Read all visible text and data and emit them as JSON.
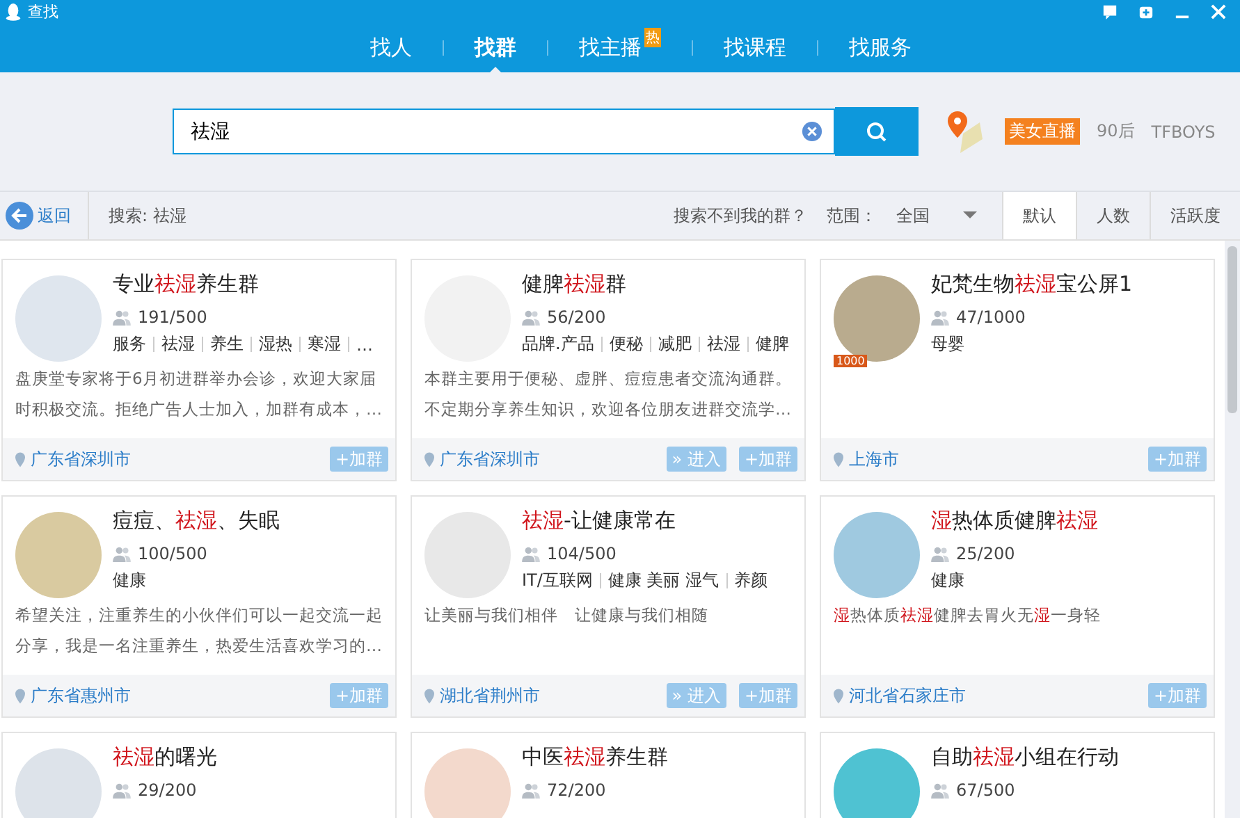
{
  "window": {
    "title": "查找"
  },
  "tabs": [
    {
      "label": "找人",
      "selected": false
    },
    {
      "label": "找群",
      "selected": true
    },
    {
      "label": "找主播",
      "selected": false,
      "badge": "热"
    },
    {
      "label": "找课程",
      "selected": false
    },
    {
      "label": "找服务",
      "selected": false
    }
  ],
  "search": {
    "value": "祛湿"
  },
  "hot_words": [
    {
      "label": "美女直播",
      "kind": "tag"
    },
    {
      "label": "90后",
      "kind": "plain"
    },
    {
      "label": "TFBOYS",
      "kind": "plain"
    }
  ],
  "toolbar": {
    "back": "返回",
    "query": "搜索: 祛湿",
    "not_found": "搜索不到我的群？",
    "scope_label": "范围：",
    "scope": "全国",
    "sorts": [
      {
        "label": "默认",
        "selected": true
      },
      {
        "label": "人数",
        "selected": false
      },
      {
        "label": "活跃度",
        "selected": false
      }
    ]
  },
  "groups": [
    {
      "title": "专业**祛湿**养生群",
      "members": "191/500",
      "tags": [
        "服务",
        "祛湿",
        "养生",
        "湿热",
        "寒湿",
        "…"
      ],
      "description": "盘庚堂专家将于6月初进群举办会诊，欢迎大家届时积极交流。拒绝广告人士加入，加群有成本，…",
      "location": "广东省深圳市",
      "buttons": [
        "+加群"
      ]
    },
    {
      "title": "健脾**祛湿**群",
      "members": "56/200",
      "tags": [
        "品牌.产品",
        "便秘",
        "减肥",
        "祛湿",
        "健脾"
      ],
      "description": "本群主要用于便秘、虚胖、痘痘患者交流沟通群。不定期分享养生知识，欢迎各位朋友进群交流学…",
      "location": "广东省深圳市",
      "buttons": [
        "» 进入",
        "+加群"
      ]
    },
    {
      "title": "妃梵生物**祛湿**宝公屏1",
      "members": "47/1000",
      "avatar_badge": "1000",
      "tags": [
        "母婴"
      ],
      "location": "上海市",
      "buttons": [
        "+加群"
      ]
    },
    {
      "title": "痘痘、**祛湿**、失眠",
      "members": "100/500",
      "tags": [
        "健康"
      ],
      "description": "希望关注，注重养生的小伙伴们可以一起交流一起分享，我是一名注重养生，热爱生活喜欢学习的…",
      "location": "广东省惠州市",
      "buttons": [
        "+加群"
      ]
    },
    {
      "title": "**祛湿**-让健康常在",
      "members": "104/500",
      "tags": [
        "IT/互联网",
        "健康 美丽 湿气",
        "养颜"
      ],
      "description": "让美丽与我们相伴　让健康与我们相随",
      "location": "湖北省荆州市",
      "buttons": [
        "» 进入",
        "+加群"
      ]
    },
    {
      "title": "**湿**热体质健脾**祛湿**",
      "members": "25/200",
      "tags": [
        "健康"
      ],
      "description": "**湿**热体质**祛湿**健脾去胃火无**湿**一身轻",
      "location": "河北省石家庄市",
      "buttons": [
        "+加群"
      ]
    },
    {
      "title": "**祛湿**的曙光",
      "members": "29/200"
    },
    {
      "title": "中医**祛湿**养生群",
      "members": "72/200"
    },
    {
      "title": "自助**祛湿**小组在行动",
      "members": "67/500"
    }
  ]
}
